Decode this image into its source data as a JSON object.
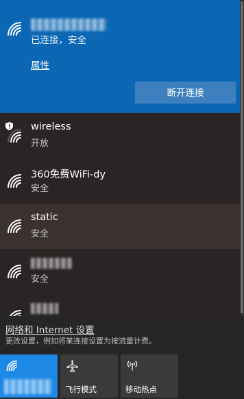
{
  "connected": {
    "status": "已连接，安全",
    "properties_link": "属性",
    "disconnect_button": "断开连接"
  },
  "networks": [
    {
      "name": "wireless",
      "status": "开放",
      "secured": false,
      "warning_shield": true
    },
    {
      "name": "360免费WiFi-dy",
      "status": "安全",
      "secured": true
    },
    {
      "name": "static",
      "status": "安全",
      "secured": true,
      "hovered": true
    },
    {
      "name": "",
      "status": "安全",
      "secured": true
    },
    {
      "name": "",
      "status": "",
      "secured": true
    }
  ],
  "settings": {
    "link": "网络和 Internet 设置",
    "description": "更改设置，例如将某连接设置为按流量计费。"
  },
  "quick_actions": [
    {
      "label": "",
      "icon": "wifi-icon",
      "active": true
    },
    {
      "label": "飞行模式",
      "icon": "airplane-icon",
      "active": false
    },
    {
      "label": "移动热点",
      "icon": "hotspot-icon",
      "active": false
    }
  ],
  "colors": {
    "accent": "#0b67b3",
    "active_tile": "#1e88e5",
    "panel": "#262626"
  }
}
